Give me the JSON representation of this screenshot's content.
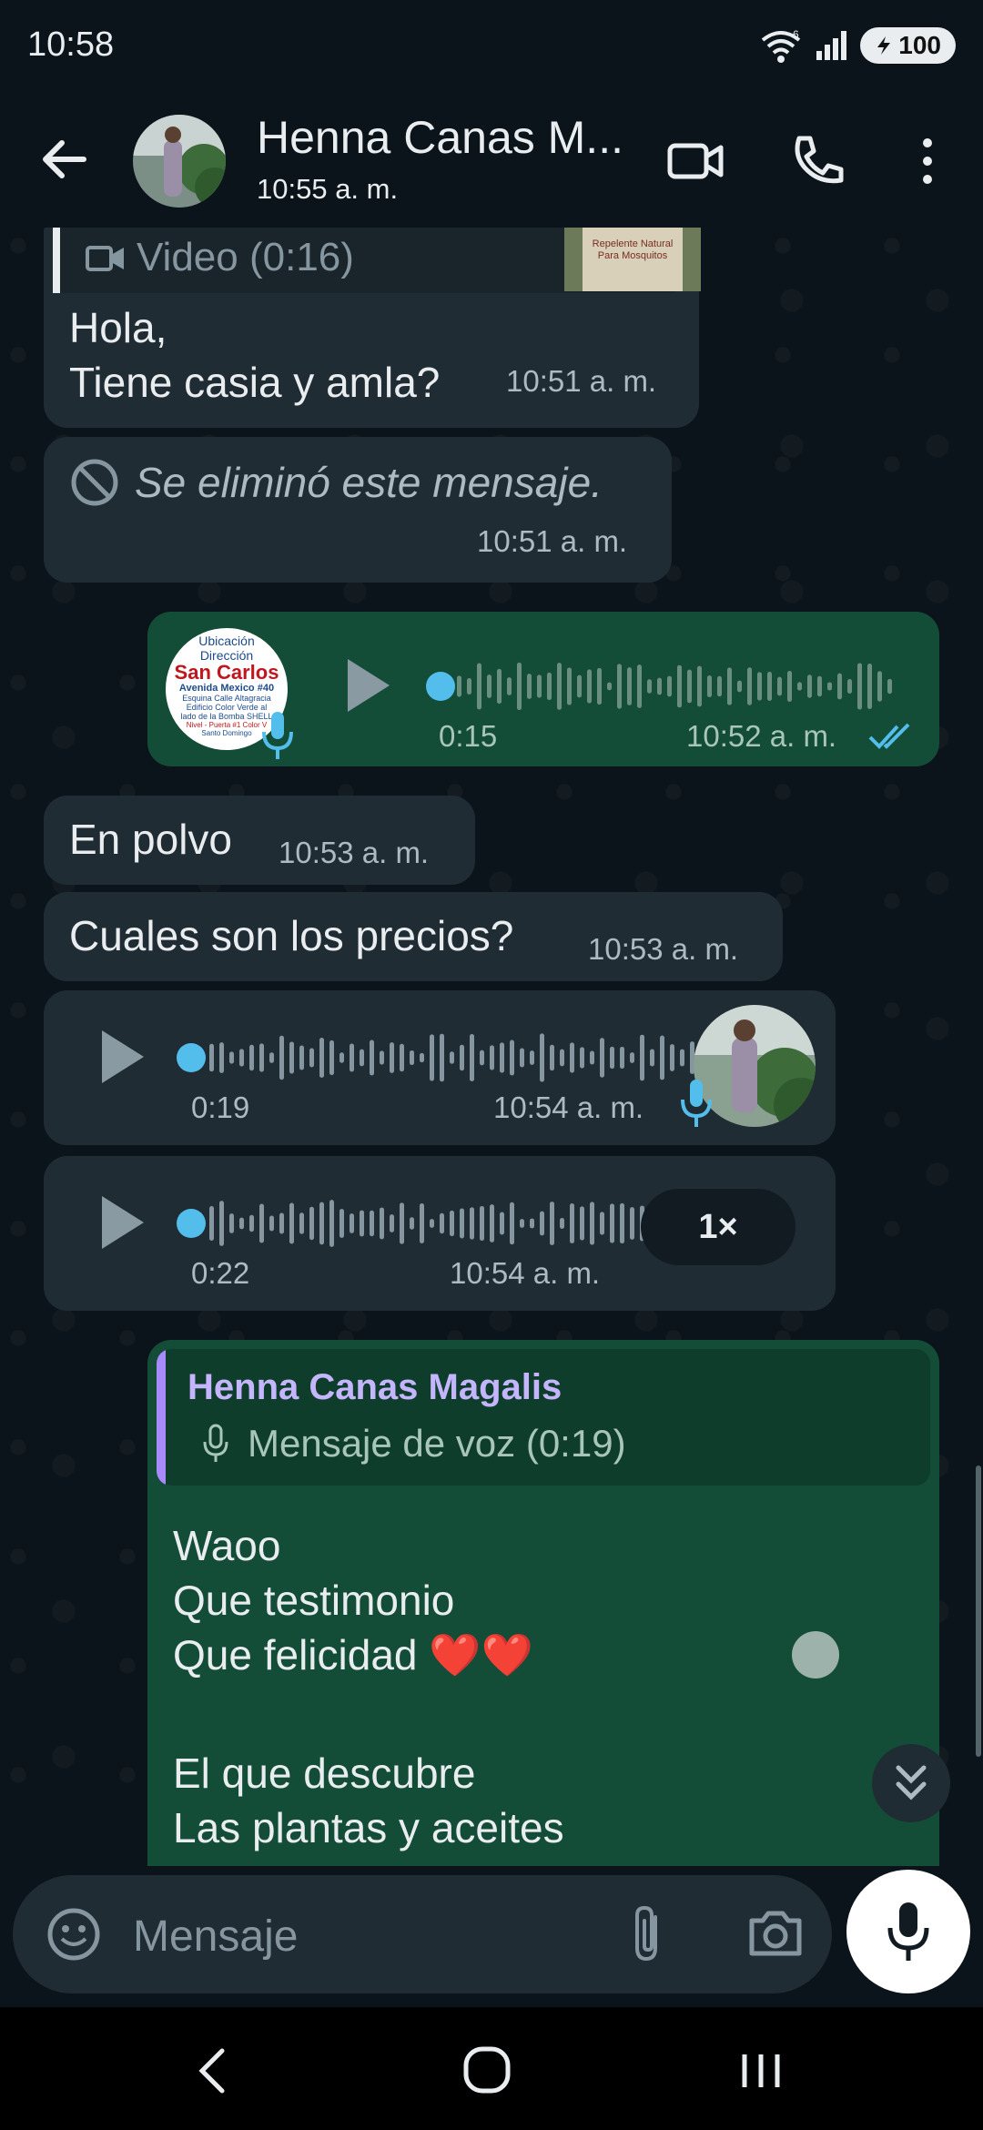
{
  "status_bar": {
    "time": "10:58",
    "battery": "100",
    "network": "6"
  },
  "header": {
    "contact_name": "Henna Canas M...",
    "last_seen": "10:55 a. m."
  },
  "messages": {
    "video_reply_label": "Video (0:16)",
    "video_thumb_caption": "Repelente Natural Para Mosquitos",
    "m1_text": "Hola,\nTiene casia y amla?",
    "m1_time": "10:51 a. m.",
    "m2_text": "Se eliminó este mensaje.",
    "m2_time": "10:51 a. m.",
    "m3_duration": "0:15",
    "m3_time": "10:52 a. m.",
    "m3_thumb": {
      "line1": "Ubicación",
      "line2": "Dirección",
      "line3": "San Carlos",
      "line4": "Avenida Mexico #40",
      "line5": "Esquina Calle Altagracia",
      "line6": "Edificio Color Verde al",
      "line7": "lado de la Bomba SHELL",
      "line8": "Nivel - Puerta #1 Color V",
      "line9": "Santo Domingo"
    },
    "m4_text": "En polvo",
    "m4_time": "10:53 a. m.",
    "m5_text": "Cuales son los precios?",
    "m5_time": "10:53 a. m.",
    "m6_duration": "0:19",
    "m6_time": "10:54 a. m.",
    "m7_duration": "0:22",
    "m7_time": "10:54 a. m.",
    "m7_speed": "1×",
    "m8_quote_author": "Henna Canas Magalis",
    "m8_quote_text": "Mensaje de voz (0:19)",
    "m8_line1": "Waoo",
    "m8_line2": "Que testimonio",
    "m8_line3": "Que felicidad ❤️❤️",
    "m8_line4": "El que descubre",
    "m8_line5": "Las plantas y aceites"
  },
  "input": {
    "placeholder": "Mensaje"
  },
  "icons": [
    "back-arrow-icon",
    "video-call-icon",
    "phone-icon",
    "more-vert-icon",
    "video-icon",
    "blocked-icon",
    "play-icon",
    "mic-icon",
    "double-check-icon",
    "emoji-icon",
    "attach-icon",
    "camera-icon",
    "scroll-down-icon",
    "nav-back-icon",
    "nav-home-icon",
    "nav-recents-icon"
  ],
  "colors": {
    "background": "#0b141a",
    "incoming_bubble": "#202c33",
    "outgoing_bubble": "#144d37",
    "accent_blue": "#53bdeb",
    "quote_bar": "#a78bfa"
  }
}
